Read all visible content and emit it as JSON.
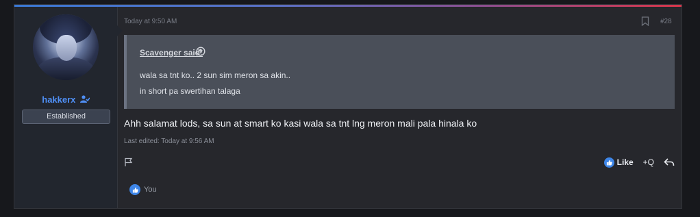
{
  "post": {
    "timestamp": "Today at 9:50 AM",
    "number": "#28",
    "message": "Ahh salamat lods, sa sun at smart ko kasi wala sa tnt lng meron mali pala hinala ko",
    "edited": "Last edited: Today at 9:56 AM"
  },
  "user": {
    "name": "hakkerx",
    "title": "Established"
  },
  "quote": {
    "author_said": "Scavenger said:",
    "lines": [
      "wala sa tnt ko.. 2 sun sim meron sa akin..",
      "in short pa swertihan talaga"
    ]
  },
  "actions": {
    "like_label": "Like",
    "quote_label": "+Q"
  },
  "reactions": {
    "summary": "You"
  },
  "colors": {
    "accent": "#4f8ff5",
    "like": "#3e86e8",
    "background": "#26272c"
  },
  "icons": [
    "bookmark-icon",
    "arrow-up-circle-icon",
    "flag-icon",
    "thumbs-up-icon",
    "reply-icon",
    "user-verified-icon"
  ]
}
